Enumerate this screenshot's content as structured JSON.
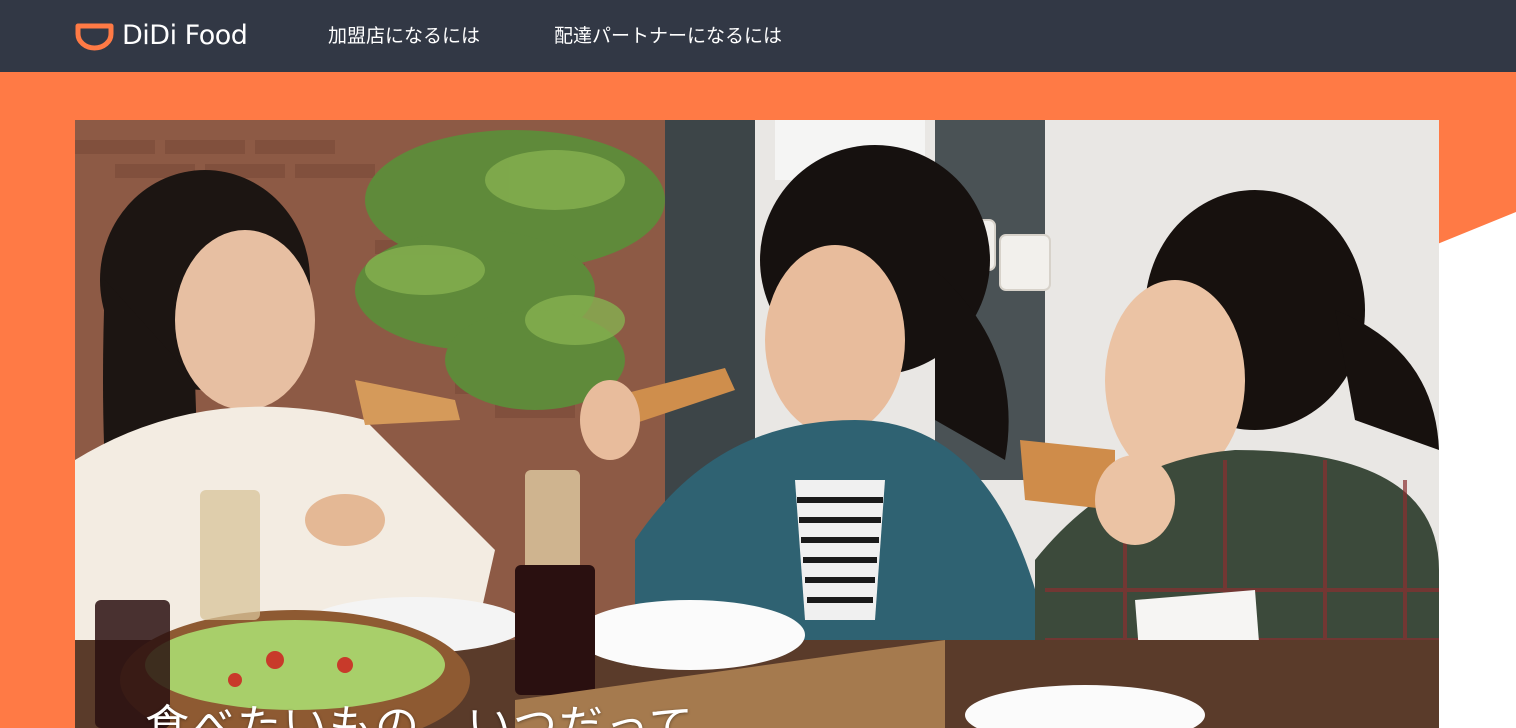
{
  "header": {
    "logo_text": "DiDi Food",
    "nav": [
      {
        "label": "加盟店になるには"
      },
      {
        "label": "配達パートナーになるには"
      }
    ],
    "background": "#323845"
  },
  "hero": {
    "title": "食べたいもの、いつだって",
    "background": "#ff7a45",
    "photo_alt": "Three women laughing and eating pizza at a dinner table"
  },
  "colors": {
    "brand_orange": "#ff7a45",
    "header_dark": "#323845"
  }
}
